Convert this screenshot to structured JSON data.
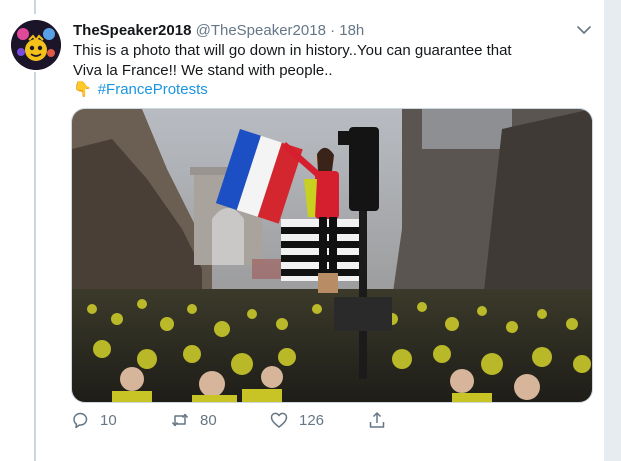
{
  "tweet": {
    "display_name": "TheSpeaker2018",
    "handle": "@TheSpeaker2018",
    "separator": "·",
    "timestamp": "18h",
    "text_line1": "This is a photo that will go down in history..You can guarantee that",
    "text_line2": "Viva la France!! We stand with people..",
    "hashtag_emoji": "👇",
    "hashtag": "#FranceProtests"
  },
  "actions": {
    "replies": "10",
    "retweets": "80",
    "likes": "126"
  },
  "icons": {
    "reply": "reply-icon",
    "retweet": "retweet-icon",
    "like": "heart-icon",
    "share": "share-icon",
    "menu": "chevron-down-icon"
  },
  "colors": {
    "link": "#1b95e0",
    "secondary_text": "#657786",
    "border": "#e6ecf0"
  }
}
